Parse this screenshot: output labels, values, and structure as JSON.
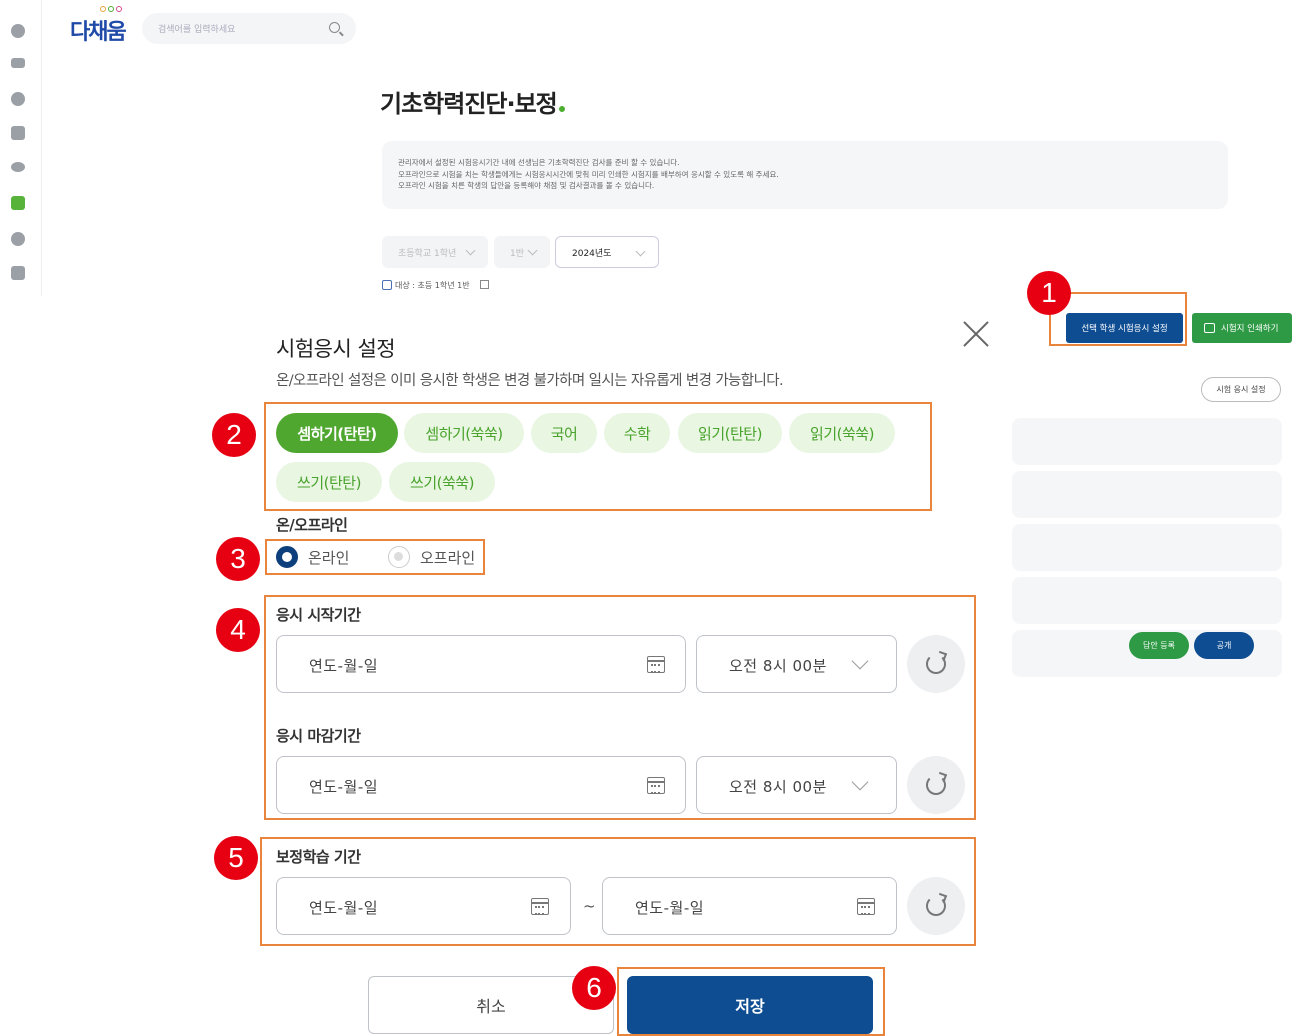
{
  "header": {
    "logo_text": "다채움",
    "search_placeholder": "검색어를 입력하세요"
  },
  "page": {
    "title": "기초학력진단·보정",
    "notice_lines": [
      "관리자에서 설정된 시험응시기간 내에 선생님은 기초학력진단 검사를 준비 할 수 있습니다.",
      "오프라인으로 시험을 치는 학생들에게는 시험응시시간에 맞춰 미리 인쇄한 시험지를 배부하여 응시할 수 있도록 해 주세요.",
      "오프라인 시험을 치른 학생의 답안을 등록해야 채점 및 검사결과를 볼 수 있습니다."
    ],
    "filters": {
      "school_grade": "초등학교 1학년",
      "class": "1반",
      "year": "2024년도"
    },
    "target_text": "대상 : 초등 1학년 1반",
    "select_button": "선택 학생 시험응시 설정",
    "print_button": "시험지 인쇄하기",
    "exam_setting_button": "시험 응시 설정",
    "answer_register_button": "답안 등록",
    "publish_button": "공개"
  },
  "modal": {
    "title": "시험응시 설정",
    "subtitle": "온/오프라인 설정은 이미 응시한 학생은 변경 불가하며 일시는 자유롭게 변경 가능합니다.",
    "subjects": [
      "셈하기(탄탄)",
      "셈하기(쑥쑥)",
      "국어",
      "수학",
      "읽기(탄탄)",
      "읽기(쑥쑥)",
      "쓰기(탄탄)",
      "쓰기(쑥쑥)"
    ],
    "selected_subject": "셈하기(탄탄)",
    "mode_label": "온/오프라인",
    "mode_online": "온라인",
    "mode_offline": "오프라인",
    "mode_selected": "온라인",
    "start_label": "응시 시작기간",
    "start_date_placeholder": "연도-월-일",
    "start_time": "오전 8시 00분",
    "end_label": "응시 마감기간",
    "end_date_placeholder": "연도-월-일",
    "end_time": "오전 8시 00분",
    "remedial_label": "보정학습 기간",
    "remedial_from_placeholder": "연도-월-일",
    "remedial_separator": "~",
    "remedial_to_placeholder": "연도-월-일",
    "cancel_button": "취소",
    "save_button": "저장"
  },
  "callouts": [
    "1",
    "2",
    "3",
    "4",
    "5",
    "6"
  ],
  "colors": {
    "primary_navy": "#0e4d92",
    "green": "#4fa730",
    "green_light": "#e8f6e2",
    "callout_red": "#e60012",
    "highlight_orange": "#e8843c"
  }
}
